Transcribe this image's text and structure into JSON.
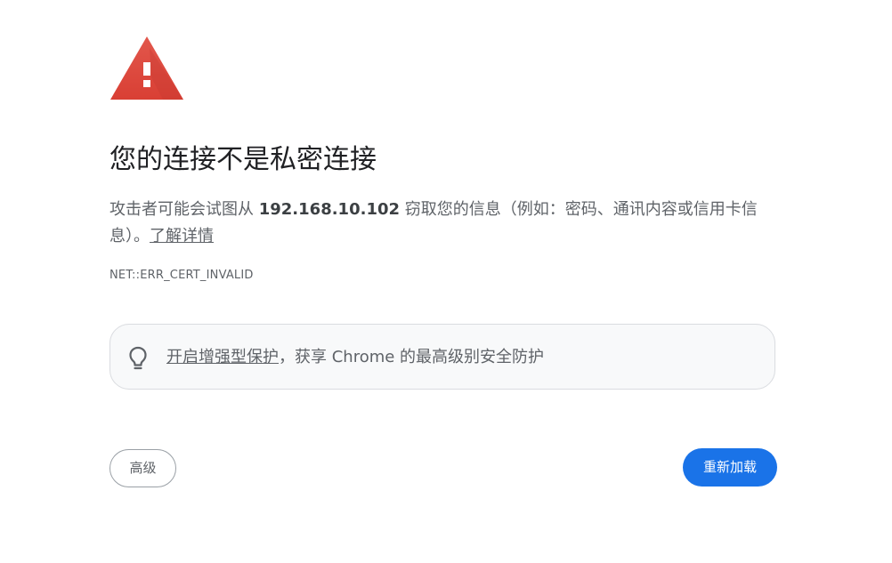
{
  "title": "您的连接不是私密连接",
  "description": {
    "prefix": "攻击者可能会试图从 ",
    "host": "192.168.10.102",
    "suffix": " 窃取您的信息（例如：密码、通讯内容或信用卡信息）。",
    "learn_more_link": "了解详情"
  },
  "error_code": "NET::ERR_CERT_INVALID",
  "enhanced_protection": {
    "icon": "lightbulb-icon",
    "link_text": "开启增强型保护",
    "suffix_text": "，获享 Chrome 的最高级别安全防护"
  },
  "buttons": {
    "advanced_label": "高级",
    "reload_label": "重新加载"
  },
  "colors": {
    "warning_red": "#db4437",
    "primary_blue": "#1a73e8",
    "box_background": "#f8f9fa"
  }
}
